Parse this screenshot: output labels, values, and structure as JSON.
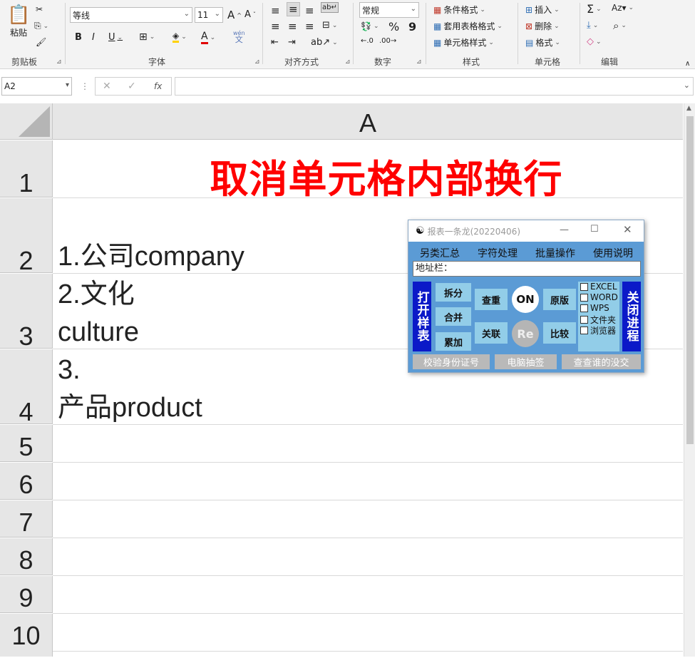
{
  "ribbon": {
    "clipboard": {
      "paste": "粘贴",
      "label": "剪贴板"
    },
    "font": {
      "name": "等线",
      "size": "11",
      "grow": "A",
      "shrink": "A",
      "bold": "B",
      "italic": "I",
      "underline": "U",
      "color_glyph": "A",
      "wen": "wén",
      "wen2": "文",
      "label": "字体"
    },
    "alignment": {
      "label": "对齐方式"
    },
    "number": {
      "format": "常规",
      "percent": "%",
      "comma": "9",
      "label": "数字"
    },
    "styles": {
      "conditional": "条件格式",
      "table": "套用表格格式",
      "cell": "单元格样式",
      "label": "样式"
    },
    "cells": {
      "insert": "插入",
      "delete": "删除",
      "format": "格式",
      "label": "单元格"
    },
    "editing": {
      "sum": "Σ",
      "sort": "A",
      "find": "⌕",
      "label": "编辑"
    }
  },
  "formula_bar": {
    "name_box": "A2",
    "cancel": "✕",
    "enter": "✓",
    "fx": "fx",
    "value": ""
  },
  "sheet": {
    "column": "A",
    "rows": [
      "1",
      "2",
      "3",
      "4",
      "5",
      "6",
      "7",
      "8",
      "9",
      "10"
    ],
    "title": "取消单元格内部换行",
    "a2": "1.公司company",
    "a3_line1": "2.文化",
    "a3_line2": "culture",
    "a4_line1": "3.",
    "a4_line2": "产品product"
  },
  "dialog": {
    "title": "报表一条龙(20220406)",
    "menu": [
      "另类汇总",
      "字符处理",
      "批量操作",
      "使用说明"
    ],
    "address_label": "地址栏：",
    "open_sample": "打开样表",
    "close_process": "关闭进程",
    "split": "拆分",
    "merge": "合并",
    "accumulate": "累加",
    "check_dup": "查重",
    "link": "关联",
    "on": "ON",
    "re": "Re",
    "original": "原版",
    "compare": "比较",
    "checkboxes": [
      "EXCEL",
      "WORD",
      "WPS",
      "文件夹",
      "浏览器"
    ],
    "bottom": [
      "校验身份证号",
      "电脑抽签",
      "查查谁的没交"
    ]
  },
  "colors": {
    "title_red": "#ff0000",
    "dialog_bg": "#5b9bd5",
    "button_light": "#92cde8",
    "button_blue": "#0b19c8"
  }
}
